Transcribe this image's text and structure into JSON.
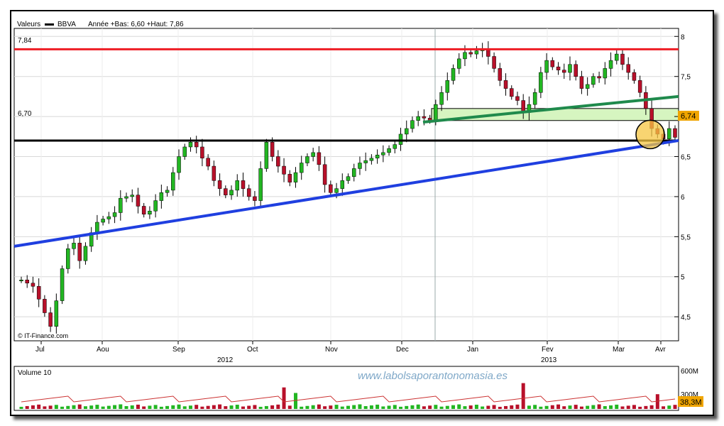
{
  "header": {
    "label_valeurs": "Valeurs",
    "ticker": "BBVA",
    "range_text": "Année +Bas: 6,60 +Haut: 7,86"
  },
  "source_label": "© IT-Finance.com",
  "watermark": "www.labolsaporantonomasia.es",
  "volume_panel": {
    "title": "Volume 10",
    "axis_labels": [
      "600M",
      "300M"
    ],
    "last_badge": "38,3M",
    "ymax": 600
  },
  "price_badge": "6,74",
  "level_labels": {
    "resistance": "7,84",
    "support": "6,70"
  },
  "chart_data": {
    "type": "candlestick",
    "title": "BBVA",
    "subtitle": "Année +Bas: 6,60 +Haut: 7,86",
    "y_ticks": [
      "8",
      "7,5",
      "7",
      "6,5",
      "6",
      "5,5",
      "5",
      "4,5"
    ],
    "y_tick_values": [
      8,
      7.5,
      7,
      6.5,
      6,
      5.5,
      5,
      4.5
    ],
    "ylim": [
      4.2,
      8.1
    ],
    "month_labels": [
      "Jul",
      "Aou",
      "Sep",
      "Oct",
      "Nov",
      "Dec",
      "Jan",
      "Fev",
      "Mar",
      "Avr"
    ],
    "year_labels": [
      "2012",
      "2013"
    ],
    "date_range": [
      "2012-07",
      "2013-04"
    ],
    "close_path": [
      4.96,
      4.92,
      4.88,
      4.72,
      4.55,
      4.38,
      4.7,
      5.1,
      5.35,
      5.42,
      5.2,
      5.38,
      5.55,
      5.68,
      5.72,
      5.75,
      5.8,
      5.98,
      6.0,
      6.02,
      5.88,
      5.78,
      5.82,
      5.95,
      6.05,
      6.08,
      6.3,
      6.5,
      6.62,
      6.68,
      6.62,
      6.48,
      6.38,
      6.2,
      6.1,
      6.02,
      6.08,
      6.2,
      6.1,
      6.0,
      5.95,
      6.35,
      6.68,
      6.5,
      6.38,
      6.28,
      6.18,
      6.3,
      6.42,
      6.5,
      6.55,
      6.4,
      6.15,
      6.05,
      6.1,
      6.2,
      6.25,
      6.35,
      6.42,
      6.45,
      6.48,
      6.52,
      6.55,
      6.6,
      6.65,
      6.78,
      6.85,
      6.95,
      7.0,
      6.98,
      6.95,
      7.15,
      7.3,
      7.45,
      7.6,
      7.72,
      7.8,
      7.78,
      7.82,
      7.84,
      7.75,
      7.6,
      7.45,
      7.35,
      7.25,
      7.2,
      7.05,
      7.15,
      7.3,
      7.55,
      7.7,
      7.62,
      7.58,
      7.55,
      7.65,
      7.5,
      7.35,
      7.4,
      7.5,
      7.48,
      7.6,
      7.7,
      7.78,
      7.65,
      7.55,
      7.45,
      7.3,
      7.1,
      6.85,
      6.78,
      6.72,
      6.85,
      6.74
    ],
    "trendlines": [
      {
        "name": "resistance",
        "color": "#ee1c24",
        "points": [
          [
            "2012-07",
            7.84
          ],
          [
            "2013-04",
            7.84
          ]
        ]
      },
      {
        "name": "support",
        "color": "#000000",
        "points": [
          [
            "2012-07",
            6.7
          ],
          [
            "2013-04",
            6.7
          ]
        ]
      },
      {
        "name": "long-term uptrend",
        "color": "#1f3fe0",
        "points": [
          [
            "2012-07",
            5.38
          ],
          [
            "2013-04",
            6.7
          ]
        ]
      },
      {
        "name": "short-term uptrend",
        "color": "#1f8a4c",
        "points": [
          [
            "2012-12",
            6.93
          ],
          [
            "2013-04",
            7.25
          ]
        ]
      }
    ],
    "highlight_zone": {
      "from": "2012-12",
      "to": "2013-04",
      "y_range": [
        6.95,
        7.1
      ],
      "color": "#d6f5c0"
    },
    "highlight_circle": {
      "date": "2013-03",
      "value": 6.74,
      "color": "#f5c542"
    },
    "grid": true,
    "vertical_marker": "2013-01-01",
    "colors": {
      "up": "#22b622",
      "down": "#b8102a"
    }
  }
}
